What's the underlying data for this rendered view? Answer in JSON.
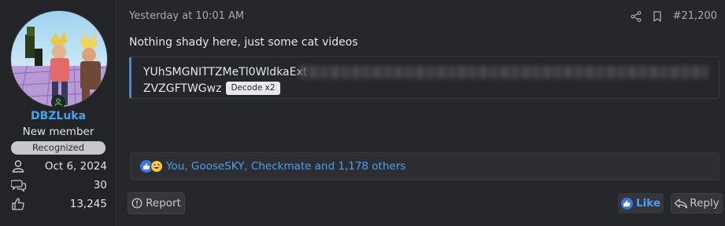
{
  "author": {
    "username": "DBZLuka",
    "user_title": "New member",
    "banner": "Recognized",
    "joined": "Oct 6, 2024",
    "messages": "30",
    "reactions": "13,245"
  },
  "post": {
    "date": "Yesterday at 10:01 AM",
    "number": "#21,200",
    "message": "Nothing shady here, just some cat videos",
    "code_line1": "YUhSMGNITTZMeTl0WldkaExt",
    "code_line2": "ZVZGFTWGwz",
    "decode_label": "Decode x2"
  },
  "reactions_bar": {
    "text": "You, GooseSKY, Checkmate and 1,178 others"
  },
  "actions": {
    "report_label": "Report",
    "like_label": "Like",
    "reply_label": "Reply"
  },
  "colors": {
    "accent": "#4aa0ea",
    "background": "#26272b"
  },
  "icons": {
    "joined": "user-icon",
    "messages": "comments-icon",
    "reactions": "thumbs-up-icon",
    "share": "share-icon",
    "bookmark": "bookmark-icon"
  }
}
